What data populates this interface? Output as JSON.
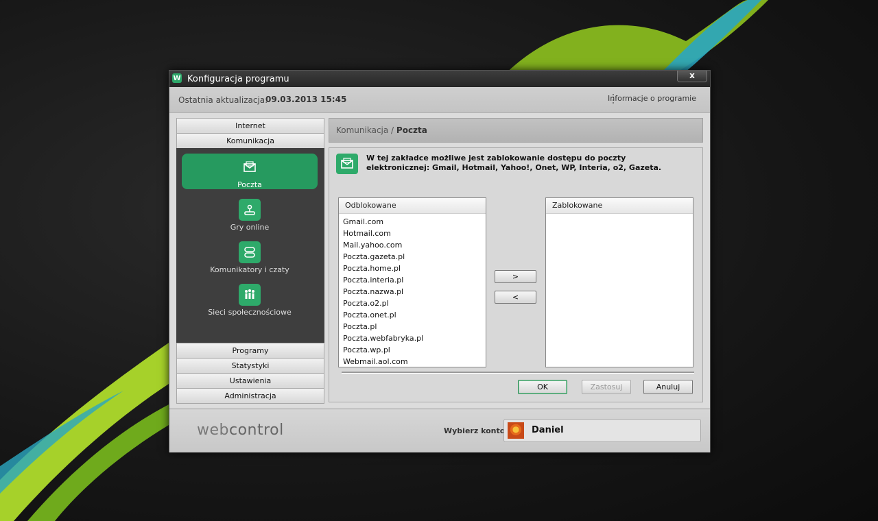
{
  "window": {
    "title": "Konfiguracja programu",
    "logo_letter": "W",
    "close": "x"
  },
  "infobar": {
    "last_update_label": "Ostatnia aktualizacja:",
    "last_update_value": "09.03.2013 15:45",
    "about": "Informacje o programie"
  },
  "sidebar": {
    "top": [
      {
        "label": "Internet"
      },
      {
        "label": "Komunikacja"
      }
    ],
    "sub": [
      {
        "label": "Poczta",
        "icon": "mail-icon",
        "active": true
      },
      {
        "label": "Gry online",
        "icon": "joystick-icon"
      },
      {
        "label": "Komunikatory i czaty",
        "icon": "chat-icon"
      },
      {
        "label": "Sieci społecznościowe",
        "icon": "people-icon"
      }
    ],
    "bottom": [
      {
        "label": "Programy"
      },
      {
        "label": "Statystyki"
      },
      {
        "label": "Ustawienia"
      },
      {
        "label": "Administracja"
      }
    ]
  },
  "breadcrumb": {
    "parent": "Komunikacja / ",
    "current": "Poczta"
  },
  "description": "W tej zakładce możliwe jest zablokowanie dostępu do poczty elektronicznej: Gmail, Hotmail, Yahoo!, Onet, WP, Interia, o2, Gazeta.",
  "lists": {
    "unblocked_header": "Odblokowane",
    "blocked_header": "Zablokowane",
    "unblocked": [
      "Gmail.com",
      "Hotmail.com",
      "Mail.yahoo.com",
      "Poczta.gazeta.pl",
      "Poczta.home.pl",
      "Poczta.interia.pl",
      "Poczta.nazwa.pl",
      "Poczta.o2.pl",
      "Poczta.onet.pl",
      "Poczta.pl",
      "Poczta.webfabryka.pl",
      "Poczta.wp.pl",
      "Webmail.aol.com"
    ],
    "blocked": []
  },
  "buttons": {
    "move_right": ">",
    "move_left": "<",
    "ok": "OK",
    "apply": "Zastosuj",
    "cancel": "Anuluj"
  },
  "footer": {
    "brand_left": "web",
    "brand_right": "control",
    "account_label": "Wybierz konto:",
    "account_name": "Daniel"
  },
  "colors": {
    "accent": "#2eaa6a",
    "accent_active": "#269a5f",
    "sidebar_bg": "#3e3e3e"
  }
}
